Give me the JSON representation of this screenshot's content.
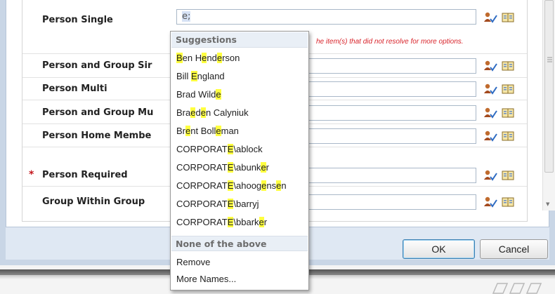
{
  "form": {
    "rows": [
      {
        "label": "Person Single",
        "typed_value": "e;",
        "required": false
      },
      {
        "label": "Person and Group Sir",
        "required": false
      },
      {
        "label": "Person Multi",
        "required": false
      },
      {
        "label": "Person and Group Mu",
        "required": false
      },
      {
        "label": "Person Home Membe",
        "required": false
      },
      {
        "label": "Person Required",
        "required": true,
        "required_mark": "*"
      },
      {
        "label": "Group Within Group",
        "required": false
      }
    ],
    "error_message": "he item(s) that did not resolve for more options."
  },
  "suggestions": {
    "header": "Suggestions",
    "items": [
      {
        "name": "Ben Henderson",
        "parts": [
          "",
          "B",
          "en H",
          "e",
          "nd",
          "e",
          "rson"
        ]
      },
      {
        "name": "Bill England",
        "parts": [
          "Bill ",
          "E",
          "ngland"
        ]
      },
      {
        "name": "Brad Wilde",
        "parts": [
          "Brad Wild",
          "e",
          ""
        ]
      },
      {
        "name": "Braeden Calyniuk",
        "parts": [
          "Bra",
          "e",
          "d",
          "e",
          "n Calyniuk"
        ]
      },
      {
        "name": "Brent Bolleman",
        "parts": [
          "Br",
          "e",
          "nt Boll",
          "e",
          "man"
        ]
      },
      {
        "name": "CORPORATE\\ablock",
        "parts": [
          "CORPORAT",
          "E",
          "\\ablock"
        ]
      },
      {
        "name": "CORPORATE\\abunker",
        "parts": [
          "CORPORAT",
          "E",
          "\\abunk",
          "e",
          "r"
        ]
      },
      {
        "name": "CORPORATE\\ahoogensen",
        "parts": [
          "CORPORAT",
          "E",
          "\\ahoog",
          "e",
          "ns",
          "e",
          "n"
        ]
      },
      {
        "name": "CORPORATE\\barryj",
        "parts": [
          "CORPORAT",
          "E",
          "\\barryj"
        ]
      },
      {
        "name": "CORPORATE\\bbarker",
        "parts": [
          "CORPORAT",
          "E",
          "\\bbark",
          "e",
          "r"
        ]
      }
    ],
    "none_header": "None of the above",
    "actions": [
      "Remove",
      "More Names..."
    ]
  },
  "buttons": {
    "ok": "OK",
    "cancel": "Cancel"
  },
  "icons": {
    "check_names": "check-names-icon",
    "browse": "address-book-icon"
  },
  "colors": {
    "highlight": "#ffff40",
    "error": "#d8232a",
    "required": "#c4161c",
    "menu_header_bg": "#e9eff6"
  }
}
